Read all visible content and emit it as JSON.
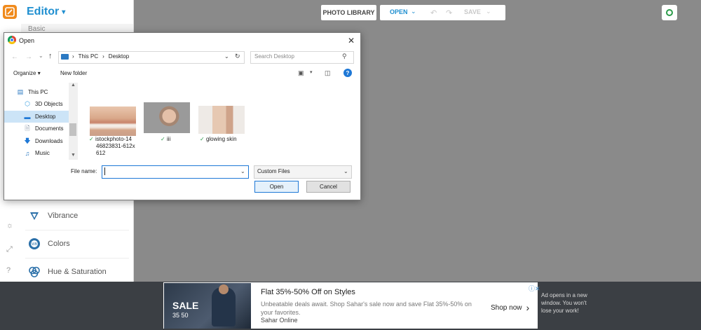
{
  "app": {
    "title": "Editor",
    "section": "Basic",
    "photo_library": "PHOTO LIBRARY",
    "open": "OPEN",
    "save": "SAVE"
  },
  "tools": [
    {
      "label": "Vibrance",
      "icon": "vibrance-icon"
    },
    {
      "label": "Colors",
      "icon": "colors-icon"
    },
    {
      "label": "Hue & Saturation",
      "icon": "hue-saturation-icon"
    }
  ],
  "side_icons": [
    "lightbulb-icon",
    "expand-icon",
    "help-icon"
  ],
  "dialog": {
    "title": "Open",
    "address": [
      "This PC",
      "Desktop"
    ],
    "search_placeholder": "Search Desktop",
    "organize": "Organize",
    "new_folder": "New folder",
    "tree": [
      "This PC",
      "3D Objects",
      "Desktop",
      "Documents",
      "Downloads",
      "Music"
    ],
    "selected_tree_item": "Desktop",
    "files": [
      {
        "name": "istockphoto-14\n46823831-612x\n612",
        "line1": "istockphoto-14",
        "line2": "46823831-612x",
        "line3": "612"
      },
      {
        "name": "iii",
        "line1": "iii"
      },
      {
        "name": "glowing skin",
        "line1": "glowing skin"
      }
    ],
    "file_name_label": "File name:",
    "file_name_value": "",
    "filter": "Custom Files",
    "open_button": "Open",
    "cancel_button": "Cancel"
  },
  "ad": {
    "headline": "Flat 35%-50% Off on Styles",
    "body": "Unbeatable deals await. Shop Sahar's sale now and save Flat 35%-50% on your favorites.",
    "brand": "Sahar Online",
    "cta": "Shop now",
    "image_sale": "SALE",
    "image_pct": "35 50",
    "note": "Ad opens in a new window. You won't lose your work!"
  },
  "colors": {
    "accent": "#1f8fd0",
    "canvas": "#8a8a8a",
    "logo": "#f08a1c",
    "ad_bar": "#3b3f44"
  }
}
